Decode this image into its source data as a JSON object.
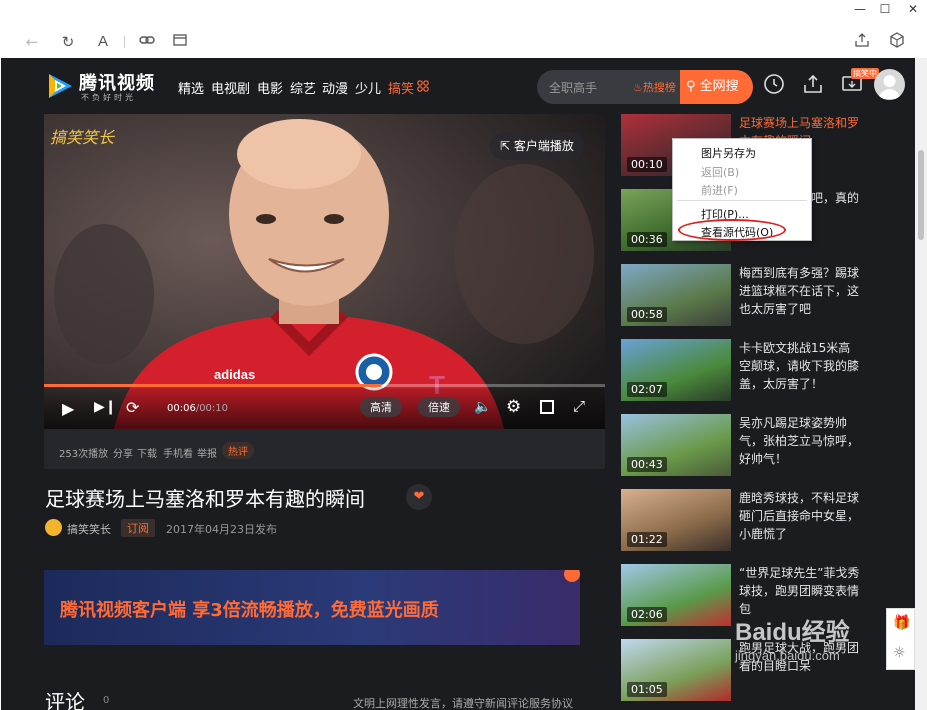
{
  "window": {
    "minimize": "—",
    "maximize": "☐",
    "close": "✕"
  },
  "toolbar": {
    "back_icon": "arrow-left-icon",
    "text_icon": "A"
  },
  "site": {
    "logo_name": "腾讯视频",
    "logo_slogan": "不负好时光",
    "nav": [
      "精选",
      "电视剧",
      "电影",
      "综艺",
      "动漫",
      "少儿",
      "搞笑"
    ],
    "search_placeholder": "全职高手",
    "hot_search": "热搜榜",
    "search_button": "全网搜",
    "badge": "搞笑中"
  },
  "player": {
    "watermark": "搞笑笑长",
    "client_play": "客户端播放",
    "time_current": "00:06",
    "time_total": "/00:10",
    "quality": "高清",
    "speed": "倍速",
    "progress": 0.6
  },
  "stats": {
    "plays": "253次播放",
    "share": "分享",
    "download": "下载",
    "mobile": "手机看",
    "report": "举报",
    "hot_comment": "热评"
  },
  "video": {
    "title": "足球赛场上马塞洛和罗本有趣的瞬间",
    "uploader": "搞笑笑长",
    "subscribe": "订阅",
    "publish_date": "2017年04月23日发布"
  },
  "banner": {
    "text": "腾讯视频客户端 享3倍流畅播放，免费蓝光画质"
  },
  "comments": {
    "title": "评论",
    "count": "0",
    "right_text": "文明上网理性发言，请遵守新闻评论服务协议"
  },
  "sidebar": [
    {
      "duration": "00:10",
      "title": "足球赛场上马塞洛和罗本有趣的瞬间",
      "active": true
    },
    {
      "duration": "00:36",
      "title": "据说小花帝球吧，真的头"
    },
    {
      "duration": "00:58",
      "title": "梅西到底有多强？踢球进篮球框不在话下，这也太厉害了吧"
    },
    {
      "duration": "02:07",
      "title": "卡卡欧文挑战15米高空颠球，请收下我的膝盖，太厉害了！"
    },
    {
      "duration": "00:43",
      "title": "吴亦凡踢足球姿势帅气，张柏芝立马惊呼，好帅气！"
    },
    {
      "duration": "01:22",
      "title": "鹿晗秀球技，不料足球砸门后直接命中女星，小鹿慌了"
    },
    {
      "duration": "02:06",
      "title": "“世界足球先生”菲戈秀球技，跑男团瞬变表情包"
    },
    {
      "duration": "01:05",
      "title": "跑男足球大战，跑男团看的目瞪口呆"
    }
  ],
  "context_menu": {
    "items": [
      "图片另存为",
      "返回(B)",
      "前进(F)",
      "打印(P)...",
      "查看源代码(O)"
    ]
  },
  "watermark": "Baidu经验",
  "watermark_url": "jingyan.baidu.com"
}
